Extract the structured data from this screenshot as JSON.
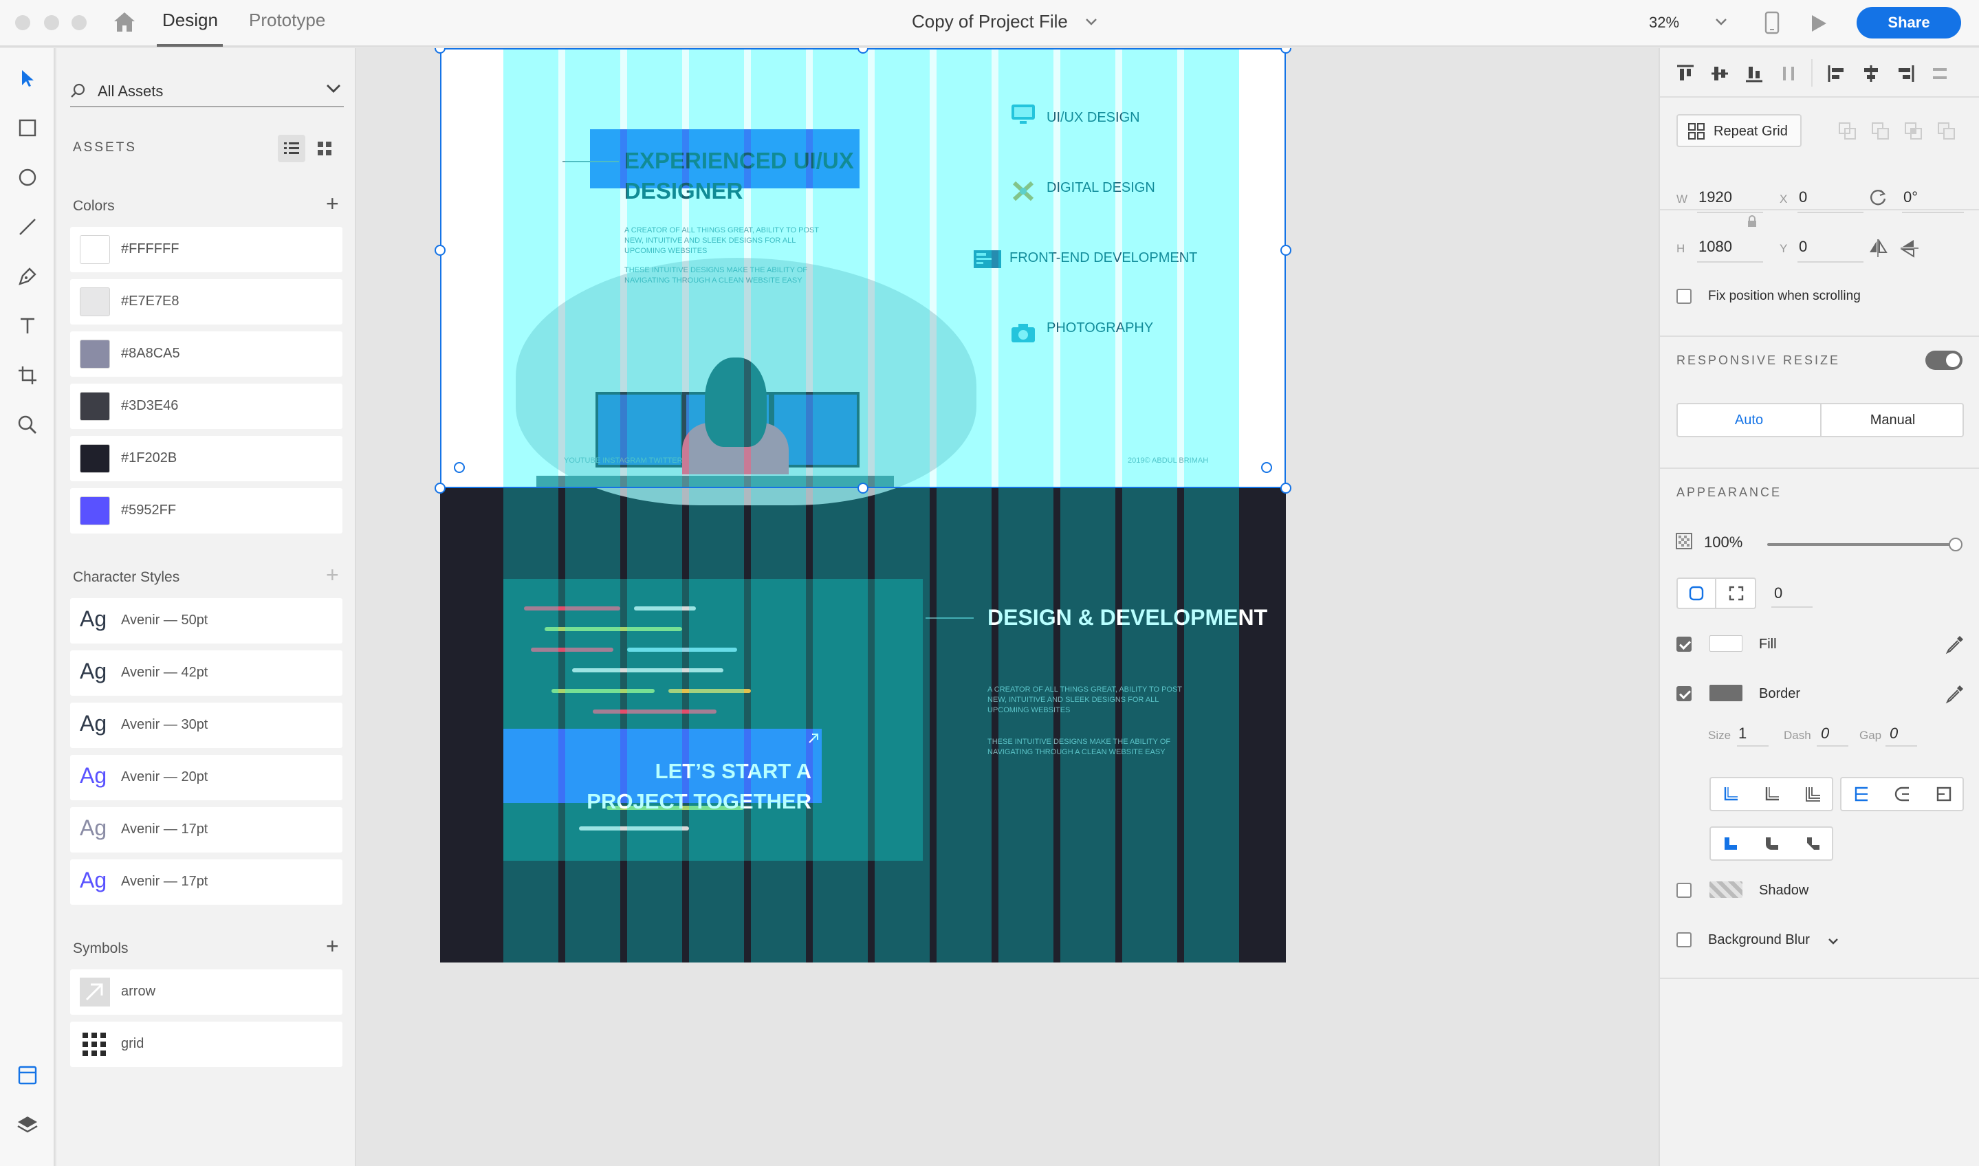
{
  "app": {
    "tabs": [
      {
        "label": "Design"
      },
      {
        "label": "Prototype"
      }
    ],
    "document_title": "Copy of Project File",
    "zoom": "32%",
    "share_label": "Share"
  },
  "assets": {
    "search_label": "All Assets",
    "header": "ASSETS",
    "colors_title": "Colors",
    "colors": [
      {
        "hex": "#FFFFFF"
      },
      {
        "hex": "#E7E7E8"
      },
      {
        "hex": "#8A8CA5"
      },
      {
        "hex": "#3D3E46"
      },
      {
        "hex": "#1F202B"
      },
      {
        "hex": "#5952FF"
      }
    ],
    "char_styles_title": "Character Styles",
    "char_styles": [
      {
        "glyph": "Ag",
        "label": "Avenir — 50pt",
        "color": "#2f3a4a"
      },
      {
        "glyph": "Ag",
        "label": "Avenir — 42pt",
        "color": "#2f3a4a"
      },
      {
        "glyph": "Ag",
        "label": "Avenir — 30pt",
        "color": "#2f3a4a"
      },
      {
        "glyph": "Ag",
        "label": "Avenir — 20pt",
        "color": "#5952ff"
      },
      {
        "glyph": "Ag",
        "label": "Avenir — 17pt",
        "color": "#8a8ca5"
      },
      {
        "glyph": "Ag",
        "label": "Avenir — 17pt",
        "color": "#5952ff"
      }
    ],
    "symbols_title": "Symbols",
    "symbols": [
      {
        "label": "arrow",
        "icon": "arrow-icon"
      },
      {
        "label": "grid",
        "icon": "grid-icon"
      }
    ]
  },
  "artboard": {
    "hero_title": "EXPERIENCED UI/UX DESIGNER",
    "hero_para_1": "A CREATOR OF ALL THINGS GREAT, ABILITY TO POST NEW, INTUITIVE AND SLEEK DESIGNS FOR ALL UPCOMING WEBSITES",
    "hero_para_2": "THESE INTUITIVE DESIGNS MAKE THE ABILITY OF NAVIGATING THROUGH A CLEAN WEBSITE EASY",
    "services": [
      {
        "label": "UI/UX DESIGN",
        "icon": "monitor-icon"
      },
      {
        "label": "DIGITAL DESIGN",
        "icon": "tools-icon"
      },
      {
        "label": "FRONT-END DEVELOPMENT",
        "icon": "code-screen-icon"
      },
      {
        "label": "PHOTOGRAPHY",
        "icon": "camera-icon"
      }
    ],
    "footer_left": "YOUTUBE    INSTAGRAM    TWITTER",
    "footer_right": "2019© ABDUL BRIMAH",
    "cta_text": "LET’S START A PROJECT TOGETHER",
    "dev_title": "DESIGN & DEVELOPMENT",
    "dev_para_1": "A CREATOR OF ALL THINGS GREAT, ABILITY TO POST NEW, INTUITIVE AND SLEEK DESIGNS FOR ALL UPCOMING WEBSITES",
    "dev_para_2": "THESE INTUITIVE DESIGNS MAKE THE ABILITY OF NAVIGATING THROUGH A CLEAN WEBSITE EASY"
  },
  "props": {
    "repeat_grid_label": "Repeat Grid",
    "w_label": "W",
    "w_value": "1920",
    "h_label": "H",
    "h_value": "1080",
    "x_label": "X",
    "x_value": "0",
    "y_label": "Y",
    "y_value": "0",
    "rotation_value": "0°",
    "fix_position_label": "Fix position when scrolling",
    "responsive_resize_label": "RESPONSIVE RESIZE",
    "responsive_on": true,
    "resize_options": [
      "Auto",
      "Manual"
    ],
    "resize_selected": "Auto",
    "appearance_label": "APPEARANCE",
    "opacity": "100%",
    "opacity_fraction": 1.0,
    "corner_radius": "0",
    "fill_label": "Fill",
    "fill_checked": true,
    "border_label": "Border",
    "border_checked": true,
    "size_label": "Size",
    "size_value": "1",
    "dash_label": "Dash",
    "dash_value": "0",
    "gap_label": "Gap",
    "gap_value": "0",
    "shadow_label": "Shadow",
    "shadow_checked": false,
    "bg_blur_label": "Background Blur",
    "bg_blur_checked": false
  },
  "colors": {
    "accent": "#1473e6",
    "grid_overlay": "#00ffff"
  }
}
